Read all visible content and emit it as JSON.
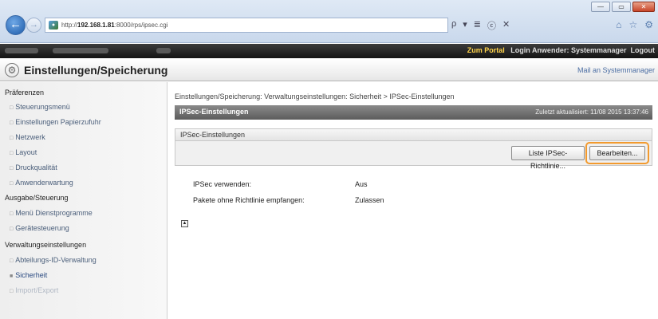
{
  "browser": {
    "url_prefix": "http://",
    "url_host": "192.168.1.81",
    "url_rest": ":8000/rps/ipsec.cgi",
    "toolbar": [
      "ρ",
      "▾",
      "≣",
      "ⓒ",
      "✕"
    ],
    "window_buttons": [
      "—",
      "▭",
      "✕"
    ],
    "fav_icons": [
      "⌂",
      "☆",
      "⚙"
    ]
  },
  "topbar": {
    "portal": "Zum Portal",
    "login_user": "Login Anwender: Systemmanager",
    "logout": "Logout"
  },
  "title": {
    "text": "Einstellungen/Speicherung",
    "mail_admin": "Mail an Systemmanager"
  },
  "sidebar": {
    "groups": [
      {
        "label": "Präferenzen",
        "items": [
          "Steuerungsmenü",
          "Einstellungen Papierzufuhr",
          "Netzwerk",
          "Layout",
          "Druckqualität",
          "Anwenderwartung"
        ]
      },
      {
        "label": "Ausgabe/Steuerung",
        "items": [
          "Menü Dienstprogramme",
          "Gerätesteuerung"
        ]
      },
      {
        "label": "Verwaltungseinstellungen",
        "items": [
          "Abteilungs-ID-Verwaltung",
          "Sicherheit",
          "Import/Export"
        ]
      }
    ]
  },
  "breadcrumb": "Einstellungen/Speicherung: Verwaltungseinstellungen: Sicherheit > IPSec-Einstellungen",
  "panel": {
    "title": "IPSec-Einstellungen",
    "last_updated": "Zuletzt aktualisiert: 11/08 2015 13:37:46",
    "section_title": "IPSec-Einstellungen",
    "btn_list": "Liste IPSec-Richtlinie...",
    "btn_edit": "Bearbeiten...",
    "rows": [
      {
        "label": "IPSec verwenden:",
        "value": "Aus"
      },
      {
        "label": "Pakete ohne Richtlinie empfangen:",
        "value": "Zulassen"
      }
    ],
    "expand_icon": "▲"
  }
}
